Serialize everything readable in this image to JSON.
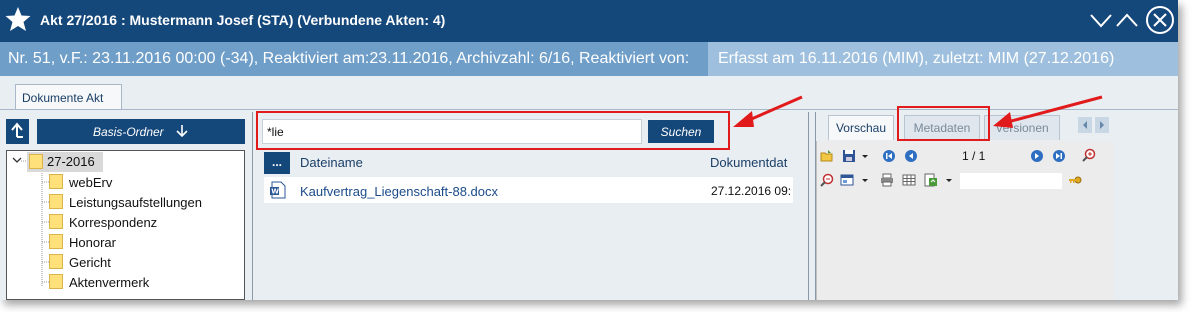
{
  "window": {
    "title": "Akt 27/2016 : Mustermann Josef (STA) (Verbundene Akten: 4)",
    "info_left": "Nr. 51, v.F.: 23.11.2016 00:00 (-34), Reaktiviert am:23.11.2016, Archivzahl: 6/16, Reaktiviert von:",
    "info_right": "Erfasst am 16.11.2016 (MIM), zuletzt: MIM (27.12.2016)",
    "colors": {
      "titlebar": "#14477a",
      "infobar": "#6f9ec8",
      "highlight": "#e11b1b"
    }
  },
  "tabs": {
    "main": "Dokumente Akt"
  },
  "left_panel": {
    "basis_button": "Basis-Ordner",
    "tree": {
      "root": "27-2016",
      "children": [
        "webErv",
        "Leistungsaufstellungen",
        "Korrespondenz",
        "Honorar",
        "Gericht",
        "Aktenvermerk"
      ]
    }
  },
  "center_panel": {
    "search_value": "*lie",
    "search_button": "Suchen",
    "columns": {
      "menu": "...",
      "name": "Dateiname",
      "date": "Dokumentdat"
    },
    "rows": [
      {
        "name": "Kaufvertrag_Liegenschaft-88.docx",
        "date": "27.12.2016 09:"
      }
    ]
  },
  "right_panel": {
    "tabs": [
      "Vorschau",
      "Metadaten",
      "Versionen"
    ],
    "page_count": "1 / 1"
  }
}
